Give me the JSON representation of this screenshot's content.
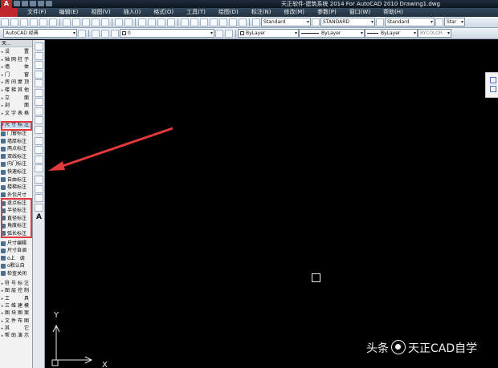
{
  "window": {
    "title": "天正软件-建筑系统 2014  For AutoCAD 2010     Drawing1.dwg"
  },
  "menu": {
    "items": [
      "文件(F)",
      "编辑(E)",
      "视图(V)",
      "插入(I)",
      "格式(O)",
      "工具(T)",
      "绘图(D)",
      "标注(N)",
      "修改(M)",
      "参数(P)",
      "窗口(W)",
      "帮助(H)"
    ]
  },
  "toolbar1": {
    "text_style": "Standard",
    "dim_style": "STANDARD",
    "table_style": "Standard",
    "multileader_style": "Star"
  },
  "toolbar2": {
    "workspace": "AutoCAD 经典",
    "layer": "0",
    "color": "ByLayer",
    "linetype": "ByLayer",
    "lineweight": "ByLayer",
    "plotstyle": "BYCOLOR"
  },
  "panel": {
    "title": "天...",
    "categories_top": [
      "设　置",
      "轴网柱子",
      "墙　体",
      "门　窗",
      "房间屋顶",
      "楼梯其他",
      "立　面",
      "剖　面",
      "文字表格"
    ],
    "active_category": "尺寸标注",
    "dimension_commands": [
      "门窗标注",
      "墙厚标注",
      "两点标注",
      "双线标注",
      "内门标注",
      "快速标注",
      "自由标注",
      "楼梯标注",
      "外包尺寸"
    ],
    "angle_commands": [
      "逐点标注",
      "半径标注",
      "直径标注",
      "角度标注",
      "弧长标注"
    ],
    "edit_commands": [
      "尺寸编辑",
      "尺寸自调",
      "o上　调",
      "o默认自",
      "检查关闭"
    ],
    "categories_bottom": [
      "符号标注",
      "图层控制",
      "工　具",
      "三维建模",
      "图块图案",
      "文件布图",
      "其　它",
      "帮助演示"
    ]
  },
  "drawbar": {
    "text_tool": "A"
  },
  "ucs": {
    "x_label": "X",
    "y_label": "Y"
  },
  "watermark": {
    "prefix": "头条",
    "name": "天正CAD自学"
  },
  "colors": {
    "canvas": "#000000",
    "highlight": "#e23a3a",
    "panel": "#f2f2f2"
  }
}
